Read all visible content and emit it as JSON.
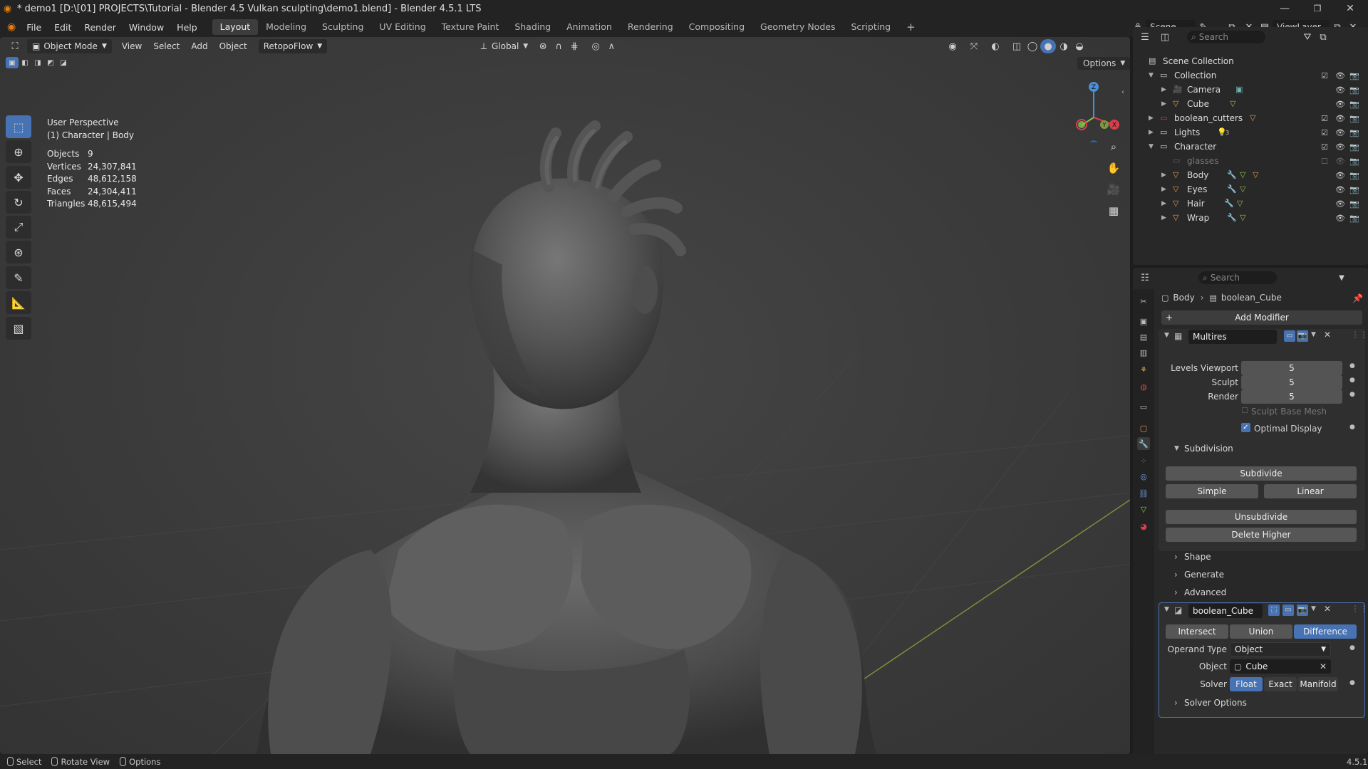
{
  "title_bar": {
    "title": "* demo1 [D:\\[01] PROJECTS\\Tutorial - Blender 4.5 Vulkan sculpting\\demo1.blend] - Blender 4.5.1 LTS",
    "minimize": "—",
    "maximize": "❐",
    "close": "✕"
  },
  "menus": [
    "File",
    "Edit",
    "Render",
    "Window",
    "Help"
  ],
  "workspaces": [
    "Layout",
    "Modeling",
    "Sculpting",
    "UV Editing",
    "Texture Paint",
    "Shading",
    "Animation",
    "Rendering",
    "Compositing",
    "Geometry Nodes",
    "Scripting"
  ],
  "active_workspace": "Layout",
  "add_workspace": "+",
  "scene": {
    "label": "Scene",
    "view_layer": "ViewLayer"
  },
  "viewport_header": {
    "mode": "Object Mode",
    "menus": [
      "View",
      "Select",
      "Add",
      "Object"
    ],
    "addon": "RetopoFlow",
    "transform_orientation": "Global",
    "options": "Options"
  },
  "viewport_overlay": {
    "perspective": "User Perspective",
    "context": "(1) Character | Body",
    "stats": [
      {
        "label": "Objects",
        "value": "9"
      },
      {
        "label": "Vertices",
        "value": "24,307,841"
      },
      {
        "label": "Edges",
        "value": "48,612,158"
      },
      {
        "label": "Faces",
        "value": "24,304,411"
      },
      {
        "label": "Triangles",
        "value": "48,615,494"
      }
    ]
  },
  "gizmo": {
    "z": "Z",
    "y": "Y",
    "x": "X"
  },
  "outliner": {
    "search_placeholder": "Search",
    "root": "Scene Collection",
    "rows": [
      {
        "label": "Collection"
      },
      {
        "label": "Camera"
      },
      {
        "label": "Cube"
      },
      {
        "label": "boolean_cutters"
      },
      {
        "label": "Lights"
      },
      {
        "label": "Character"
      },
      {
        "label": "glasses"
      },
      {
        "label": "Body"
      },
      {
        "label": "Eyes"
      },
      {
        "label": "Hair"
      },
      {
        "label": "Wrap"
      }
    ],
    "lights_count": "3"
  },
  "properties": {
    "search_placeholder": "Search",
    "breadcrumb_object": "Body",
    "breadcrumb_modifier": "boolean_Cube",
    "add_modifier": "Add Modifier",
    "multires": {
      "name": "Multires",
      "levels_viewport_label": "Levels Viewport",
      "levels_viewport": "5",
      "sculpt_label": "Sculpt",
      "sculpt": "5",
      "render_label": "Render",
      "render": "5",
      "sculpt_base_mesh": "Sculpt Base Mesh",
      "optimal_display": "Optimal Display",
      "subdivision_label": "Subdivision",
      "subdivide": "Subdivide",
      "simple": "Simple",
      "linear": "Linear",
      "unsubdivide": "Unsubdivide",
      "delete_higher": "Delete Higher",
      "shape": "Shape",
      "generate": "Generate",
      "advanced": "Advanced"
    },
    "boolean": {
      "name": "boolean_Cube",
      "intersect": "Intersect",
      "union": "Union",
      "difference": "Difference",
      "operand_type_label": "Operand Type",
      "operand_type": "Object",
      "object_label": "Object",
      "object": "Cube",
      "solver_label": "Solver",
      "float": "Float",
      "exact": "Exact",
      "manifold": "Manifold",
      "solver_options": "Solver Options"
    }
  },
  "status_bar": {
    "select": "Select",
    "rotate_view": "Rotate View",
    "options": "Options",
    "version": "4.5.1"
  },
  "colors": {
    "accent": "#4772b3",
    "x_axis": "#d6404c",
    "y_axis": "#8bc34a",
    "z_axis": "#4a8fd8"
  }
}
